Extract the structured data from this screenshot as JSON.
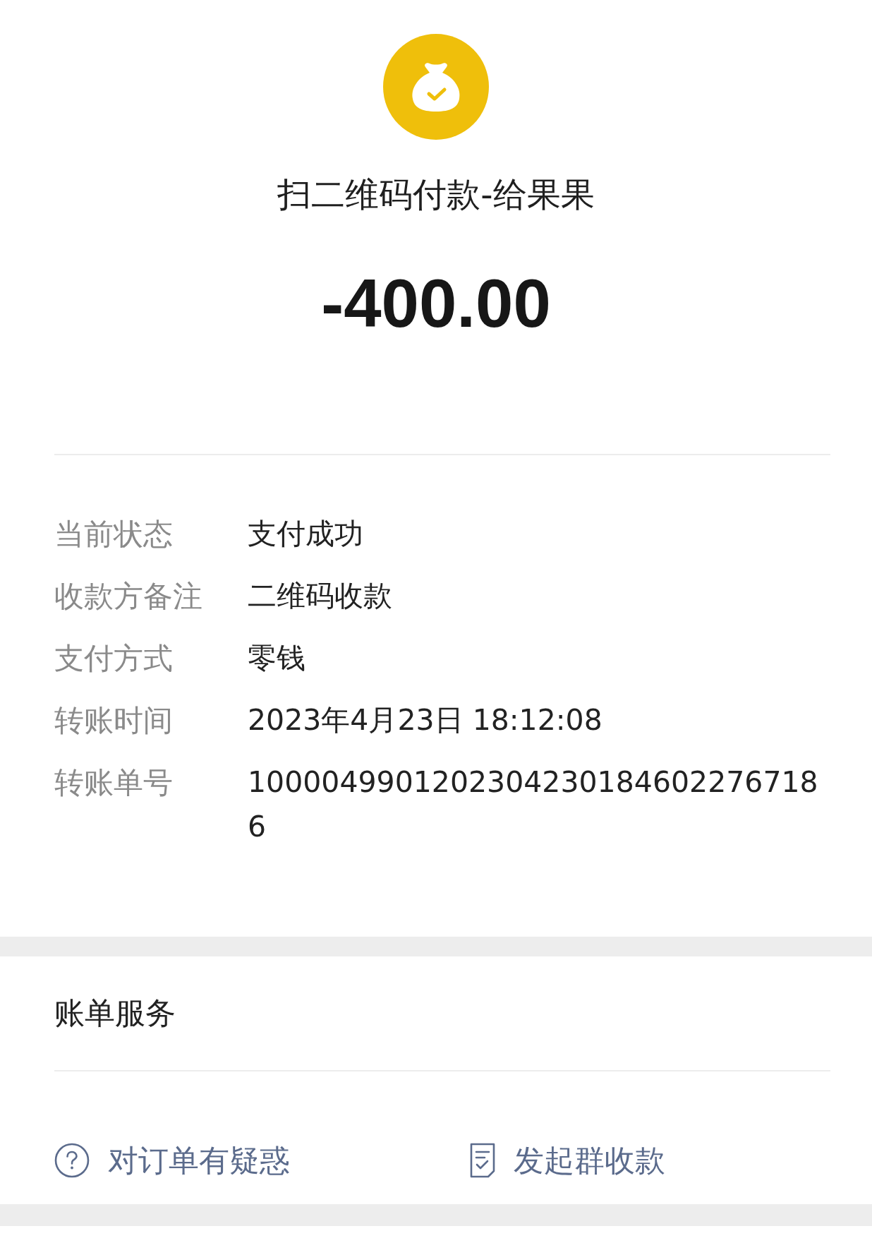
{
  "header": {
    "title": "扫二维码付款-给果果",
    "amount": "-400.00"
  },
  "details": [
    {
      "label": "当前状态",
      "value": "支付成功"
    },
    {
      "label": "收款方备注",
      "value": "二维码收款"
    },
    {
      "label": "支付方式",
      "value": "零钱"
    },
    {
      "label": "转账时间",
      "value": "2023年4月23日 18:12:08"
    },
    {
      "label": "转账单号",
      "value": "10000499012023042301846022767186"
    }
  ],
  "services": {
    "title": "账单服务",
    "actions": [
      {
        "kind": "question",
        "label": "对订单有疑惑"
      },
      {
        "kind": "receipt",
        "label": "发起群收款"
      }
    ]
  }
}
